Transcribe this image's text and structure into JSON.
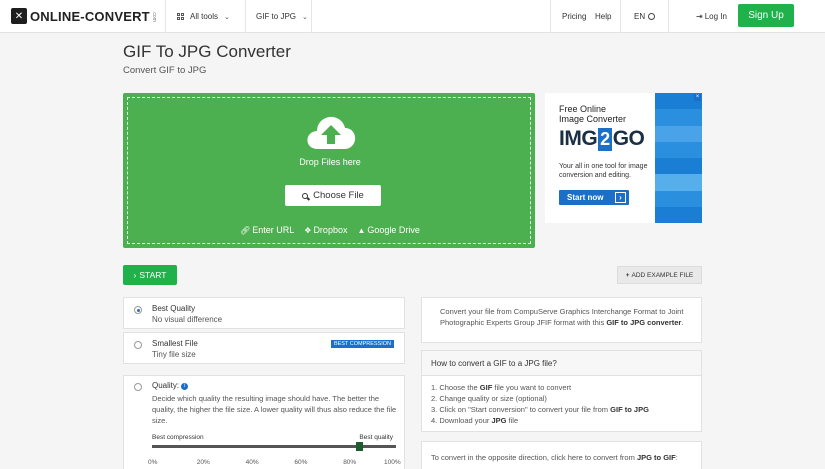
{
  "header": {
    "logo": "ONLINE-CONVERT",
    "logo_sub": ".com",
    "all_tools": "All tools",
    "current_tool": "GIF to JPG",
    "pricing": "Pricing",
    "help": "Help",
    "language": "EN",
    "login": "Log In",
    "signup": "Sign Up"
  },
  "page": {
    "title": "GIF To JPG Converter",
    "subtitle": "Convert GIF to JPG"
  },
  "upload": {
    "drop_text": "Drop Files here",
    "choose_file": "Choose File",
    "enter_url": "Enter URL",
    "dropbox": "Dropbox",
    "google_drive": "Google Drive"
  },
  "ad": {
    "headline_1": "Free Online",
    "headline_2": "Image Converter",
    "logo_left": "IMG",
    "logo_mid": "2",
    "logo_right": "GO",
    "desc": "Your all in one tool for image conversion and editing.",
    "cta": "Start now",
    "close": "×",
    "stripe_colors": [
      "#1a7fd4",
      "#2b8fe0",
      "#4aa3e8",
      "#2b8fe0",
      "#1a7fd4",
      "#56aeea",
      "#2b8fe0",
      "#1a7fd4"
    ]
  },
  "actions": {
    "start": "START",
    "add_example": "ADD EXAMPLE FILE"
  },
  "options": {
    "best_quality": {
      "title": "Best Quality",
      "sub": "No visual difference",
      "selected": true
    },
    "smallest_file": {
      "title": "Smallest File",
      "sub": "Tiny file size",
      "badge": "BEST COMPRESSION",
      "selected": false
    },
    "quality": {
      "title": "Quality:",
      "desc": "Decide which quality the resulting image should have. The better the quality, the higher the file size. A lower quality will thus also reduce the file size.",
      "left_label": "Best compression",
      "right_label": "Best quality",
      "value_percent": 85,
      "ticks": [
        "0%",
        "20%",
        "40%",
        "60%",
        "80%",
        "100%"
      ]
    }
  },
  "info": {
    "intro_1": "Convert your file from CompuServe Graphics Interchange Format to Joint Photographic Experts Group JFIF format with this ",
    "intro_bold": "GIF to JPG converter",
    "intro_2": ".",
    "howto_title": "How to convert a GIF to a JPG file?",
    "step1_a": "1. Choose the ",
    "step1_b": "GIF",
    "step1_c": " file you want to convert",
    "step2": "2. Change quality or size (optional)",
    "step3_a": "3. Click on \"Start conversion\" to convert your file from ",
    "step3_b": "GIF to JPG",
    "step4_a": "4. Download your ",
    "step4_b": "JPG",
    "step4_c": " file",
    "opposite_a": "To convert in the opposite direction, click here to convert from ",
    "opposite_b": "JPG to GIF",
    "opposite_c": ":"
  }
}
